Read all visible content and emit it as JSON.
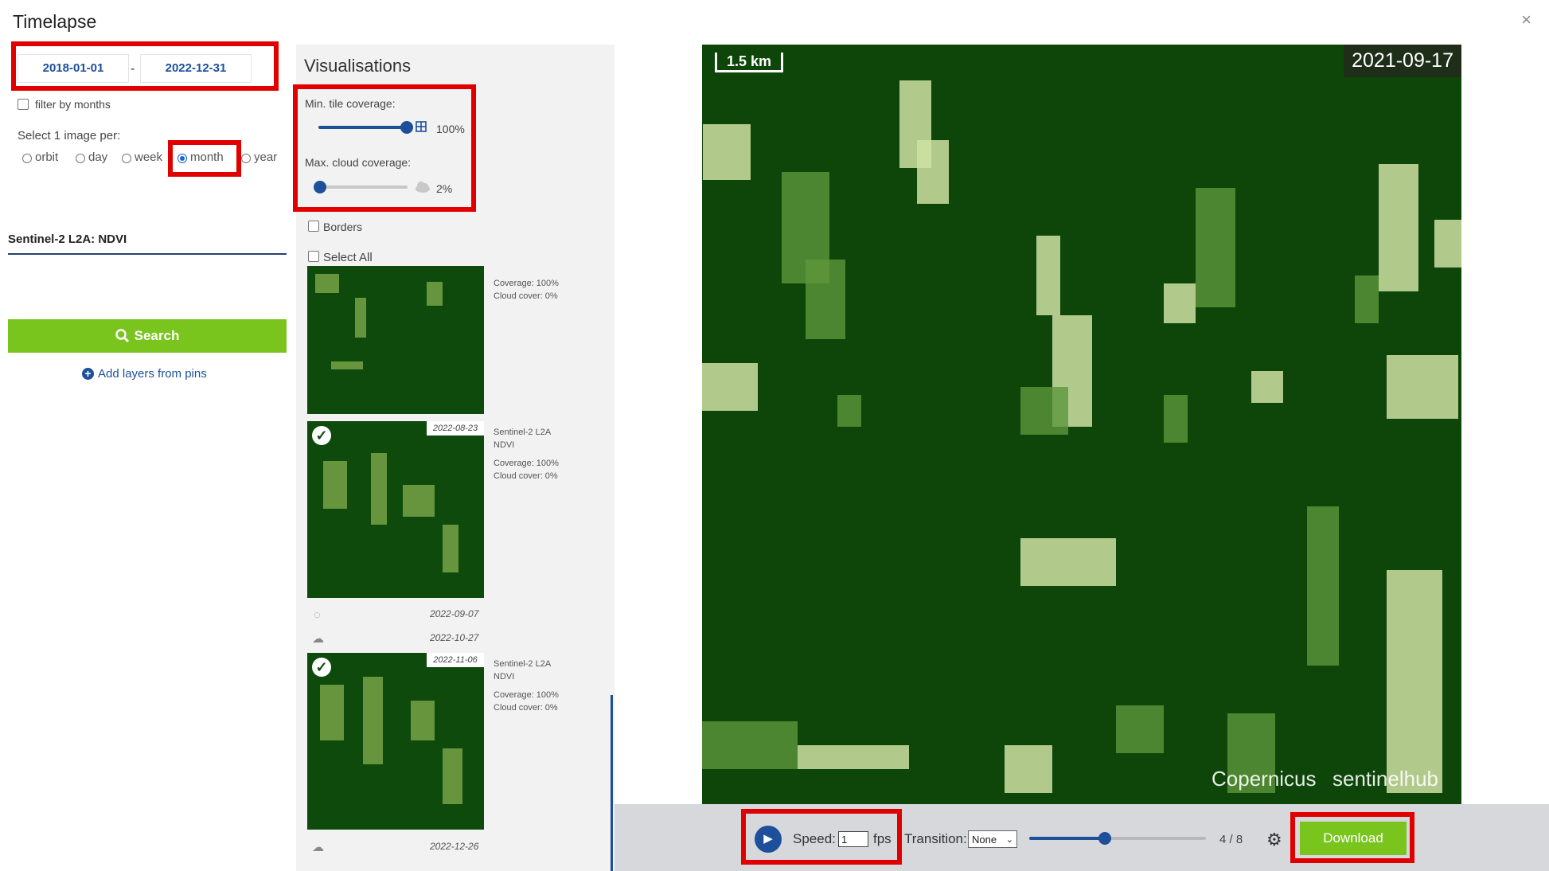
{
  "header": {
    "title": "Timelapse",
    "close_glyph": "×"
  },
  "dates": {
    "from": "2018-01-01",
    "separator": "-",
    "to": "2022-12-31"
  },
  "filter_by_months": {
    "label": "filter by months",
    "checked": false
  },
  "select_per": {
    "label": "Select 1 image per:",
    "options": [
      "orbit",
      "day",
      "week",
      "month",
      "year"
    ],
    "selected": "month"
  },
  "layer": {
    "name": "Sentinel-2 L2A: NDVI"
  },
  "search": {
    "label": "Search",
    "icon": "search-icon"
  },
  "add_layers": {
    "label": "Add layers from pins"
  },
  "visualisations": {
    "title": "Visualisations",
    "min_tile_coverage": {
      "label": "Min. tile coverage:",
      "value_label": "100%",
      "value": 100
    },
    "max_cloud_coverage": {
      "label": "Max. cloud coverage:",
      "value_label": "2%",
      "value": 2
    },
    "borders": {
      "label": "Borders",
      "checked": false
    },
    "select_all": {
      "label": "Select All",
      "checked": false
    }
  },
  "images": [
    {
      "coverage": "Coverage: 100%",
      "cloud": "Cloud cover: 0%"
    },
    {
      "date": "2022-08-23",
      "title": "Sentinel-2 L2A",
      "layer": "NDVI",
      "coverage": "Coverage: 100%",
      "cloud": "Cloud cover: 0%",
      "selected": true
    },
    {
      "date": "2022-09-07",
      "icon": "loading-icon"
    },
    {
      "date": "2022-10-27",
      "icon": "cloud-sun-icon"
    },
    {
      "date": "2022-11-06",
      "title": "Sentinel-2 L2A",
      "layer": "NDVI",
      "coverage": "Coverage: 100%",
      "cloud": "Cloud cover: 0%",
      "selected": true
    },
    {
      "date": "2022-12-26",
      "icon": "cloud-sun-icon"
    }
  ],
  "map": {
    "scale": "1.5 km",
    "date": "2021-09-17",
    "logo_left": "Copernicus",
    "logo_right": "sentinelhub"
  },
  "player": {
    "speed_label": "Speed:",
    "speed_value": "1",
    "fps_label": "fps",
    "transition_label": "Transition:",
    "transition_value": "None",
    "frame_label": "4 / 8",
    "frame": 4,
    "frames_total": 8,
    "download_label": "Download"
  },
  "colors": {
    "accent_green": "#79c51e",
    "brand_blue": "#1d4f9a",
    "highlight_red": "#e10000",
    "map_dark": "#0d4608"
  }
}
